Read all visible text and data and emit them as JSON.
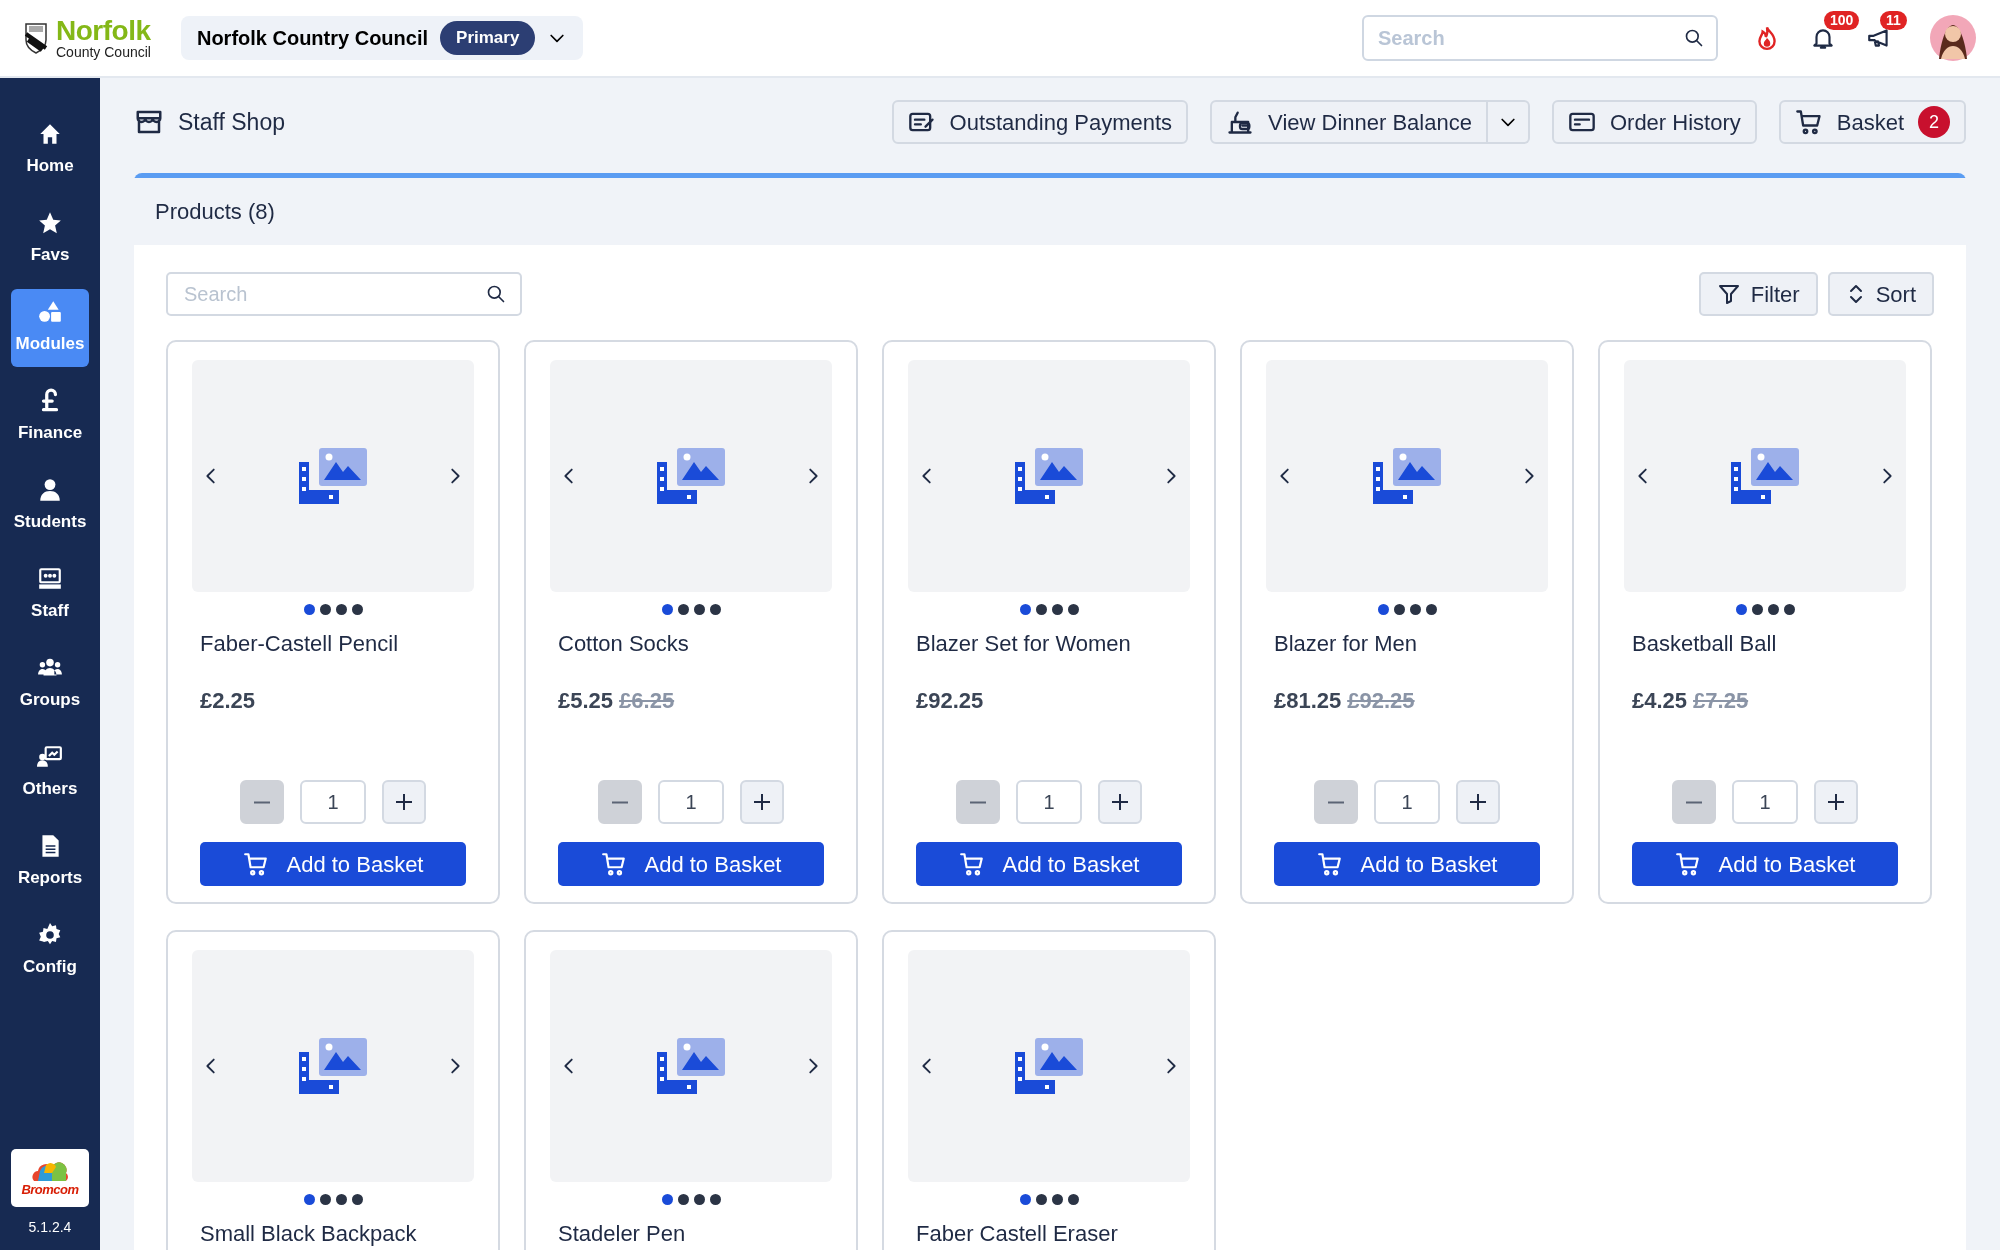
{
  "topbar": {
    "logo": {
      "line1": "Norfolk",
      "line2": "County Council"
    },
    "organisation": {
      "name": "Norfolk Country Council",
      "badge": "Primary"
    },
    "search": {
      "placeholder": "Search"
    },
    "notifications": [
      {
        "count": "100"
      },
      {
        "count": "11"
      }
    ]
  },
  "sidebar": {
    "items": [
      {
        "label": "Home",
        "selected": false
      },
      {
        "label": "Favs",
        "selected": false
      },
      {
        "label": "Modules",
        "selected": true
      },
      {
        "label": "Finance",
        "selected": false
      },
      {
        "label": "Students",
        "selected": false
      },
      {
        "label": "Staff",
        "selected": false
      },
      {
        "label": "Groups",
        "selected": false
      },
      {
        "label": "Others",
        "selected": false
      },
      {
        "label": "Reports",
        "selected": false
      },
      {
        "label": "Config",
        "selected": false
      }
    ],
    "brand": "Bromcom",
    "version": "5.1.2.4"
  },
  "page": {
    "title": "Staff Shop",
    "actions": [
      {
        "label": "Outstanding Payments",
        "kind": "button"
      },
      {
        "label": "View Dinner Balance",
        "kind": "split"
      },
      {
        "label": "Order History",
        "kind": "button"
      },
      {
        "label": "Basket",
        "kind": "button",
        "badge": "2"
      }
    ]
  },
  "panel": {
    "title": "Products (8)",
    "search": {
      "placeholder": "Search"
    },
    "filter": "Filter",
    "sort": "Sort",
    "products": [
      {
        "name": "Faber-Castell Pencil",
        "price": "£2.25",
        "quantity": "1",
        "decrease_disabled": true,
        "button": "Add to Basket",
        "slides": [
          {
            "selected": true
          },
          {
            "selected": false
          },
          {
            "selected": false
          },
          {
            "selected": false
          }
        ]
      },
      {
        "name": "Cotton Socks",
        "price": "£5.25",
        "old_price": "£6.25",
        "quantity": "1",
        "decrease_disabled": true,
        "button": "Add to Basket",
        "slides": [
          {
            "selected": true
          },
          {
            "selected": false
          },
          {
            "selected": false
          },
          {
            "selected": false
          }
        ]
      },
      {
        "name": "Blazer Set for Women",
        "price": "£92.25",
        "quantity": "1",
        "decrease_disabled": true,
        "button": "Add to Basket",
        "slides": [
          {
            "selected": true
          },
          {
            "selected": false
          },
          {
            "selected": false
          },
          {
            "selected": false
          }
        ]
      },
      {
        "name": "Blazer for Men",
        "price": "£81.25",
        "old_price": "£92.25",
        "quantity": "1",
        "decrease_disabled": true,
        "button": "Add to Basket",
        "slides": [
          {
            "selected": true
          },
          {
            "selected": false
          },
          {
            "selected": false
          },
          {
            "selected": false
          }
        ]
      },
      {
        "name": "Basketball Ball",
        "price": "£4.25",
        "old_price": "£7.25",
        "quantity": "1",
        "decrease_disabled": true,
        "button": "Add to Basket",
        "slides": [
          {
            "selected": true
          },
          {
            "selected": false
          },
          {
            "selected": false
          },
          {
            "selected": false
          }
        ]
      },
      {
        "name": "Small Black Backpack",
        "slides": [
          {
            "selected": true
          },
          {
            "selected": false
          },
          {
            "selected": false
          },
          {
            "selected": false
          }
        ]
      },
      {
        "name": "Stadeler Pen",
        "slides": [
          {
            "selected": true
          },
          {
            "selected": false
          },
          {
            "selected": false
          },
          {
            "selected": false
          }
        ]
      },
      {
        "name": "Faber Castell Eraser",
        "slides": [
          {
            "selected": true
          },
          {
            "selected": false
          },
          {
            "selected": false
          },
          {
            "selected": false
          }
        ]
      }
    ]
  }
}
